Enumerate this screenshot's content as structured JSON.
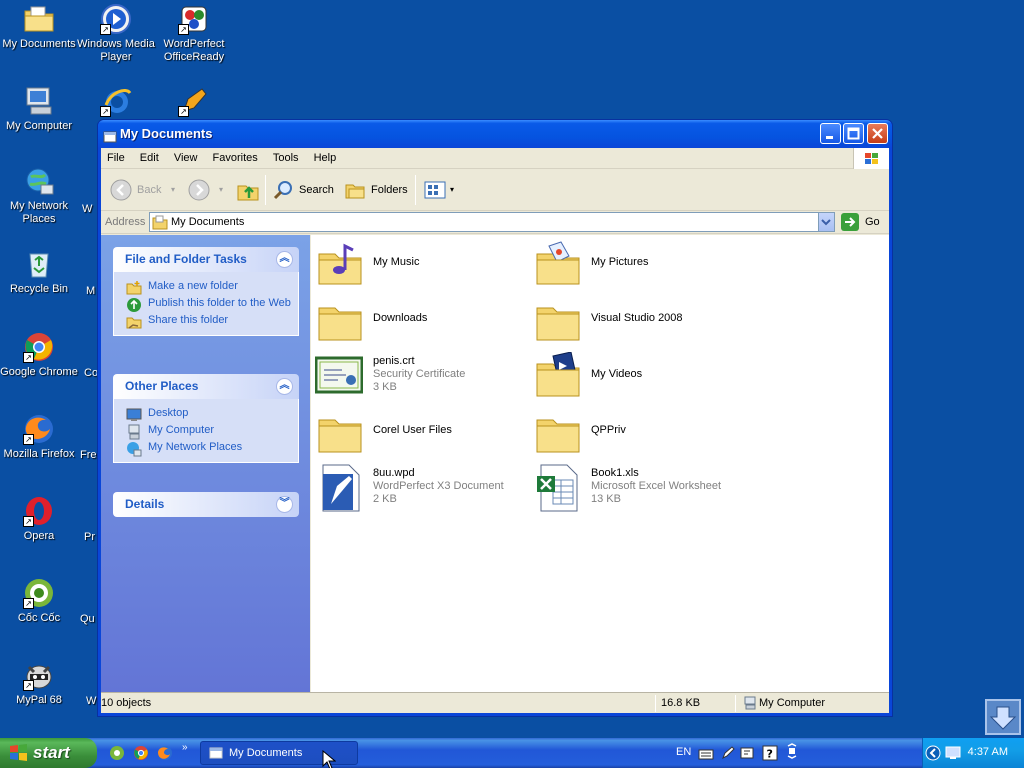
{
  "desktop": {
    "icons_col1": [
      "My Documents",
      "My Computer",
      "My Network Places",
      "Recycle Bin",
      "Google Chrome",
      "Mozilla Firefox",
      "Opera",
      "Cốc Cốc",
      "MyPal 68"
    ],
    "icons_col2": [
      "Windows Media Player",
      "Internet Explorer",
      "WordPerfect OfficeReady"
    ],
    "partial_labels": [
      "W",
      "M",
      "Co",
      "Fre",
      "Pr",
      "Qu",
      "W"
    ]
  },
  "window": {
    "title": "My Documents",
    "menu": [
      "File",
      "Edit",
      "View",
      "Favorites",
      "Tools",
      "Help"
    ],
    "toolbar": {
      "back": "Back",
      "search": "Search",
      "folders": "Folders"
    },
    "address": {
      "label": "Address",
      "value": "My Documents",
      "go": "Go"
    },
    "task_pane": {
      "file_folder_tasks": {
        "title": "File and Folder Tasks",
        "items": [
          "Make a new folder",
          "Publish this folder to the Web",
          "Share this folder"
        ]
      },
      "other_places": {
        "title": "Other Places",
        "items": [
          "Desktop",
          "My Computer",
          "My Network Places"
        ]
      },
      "details": {
        "title": "Details"
      }
    },
    "files": [
      {
        "name": "My Music",
        "type": "",
        "size": "",
        "icon": "music-folder-icon"
      },
      {
        "name": "My Pictures",
        "type": "",
        "size": "",
        "icon": "pictures-folder-icon"
      },
      {
        "name": "Downloads",
        "type": "",
        "size": "",
        "icon": "folder-icon"
      },
      {
        "name": "Visual Studio 2008",
        "type": "",
        "size": "",
        "icon": "folder-icon"
      },
      {
        "name": "penis.crt",
        "type": "Security Certificate",
        "size": "3 KB",
        "icon": "certificate-icon"
      },
      {
        "name": "My Videos",
        "type": "",
        "size": "",
        "icon": "videos-folder-icon"
      },
      {
        "name": "Corel User Files",
        "type": "",
        "size": "",
        "icon": "folder-icon"
      },
      {
        "name": "QPPriv",
        "type": "",
        "size": "",
        "icon": "folder-icon"
      },
      {
        "name": "8uu.wpd",
        "type": "WordPerfect X3 Document",
        "size": "2 KB",
        "icon": "wordperfect-doc-icon"
      },
      {
        "name": "Book1.xls",
        "type": "Microsoft Excel Worksheet",
        "size": "13 KB",
        "icon": "excel-doc-icon"
      }
    ],
    "status": {
      "objects": "10 objects",
      "size": "16.8 KB",
      "location": "My Computer"
    }
  },
  "taskbar": {
    "start": "start",
    "task_button": "My Documents",
    "language": "EN",
    "clock": "4:37 AM"
  },
  "colors": {
    "desktop": "#0a4fa3",
    "titlebar": "#0554e0",
    "taskpane": "#7ba2e7",
    "link": "#215dc6",
    "start": "#3a8e3a"
  }
}
